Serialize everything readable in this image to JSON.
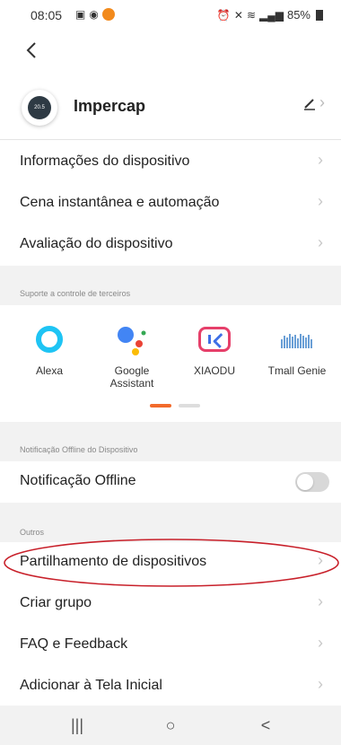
{
  "status_bar": {
    "time": "08:05",
    "battery": "85%"
  },
  "device": {
    "name": "Impercap",
    "avatar_text": "20.5"
  },
  "menu": {
    "info": "Informações do dispositivo",
    "scene": "Cena instantânea e automação",
    "rating": "Avaliação do dispositivo"
  },
  "third_party": {
    "section_label": "Suporte a controle de terceiros",
    "items": [
      {
        "label": "Alexa",
        "icon": "alexa-icon"
      },
      {
        "label": "Google Assistant",
        "icon": "google-assistant-icon"
      },
      {
        "label": "XIAODU",
        "icon": "xiaodu-icon"
      },
      {
        "label": "Tmall Genie",
        "icon": "tmall-genie-icon"
      }
    ],
    "active_page": 1,
    "page_count": 2
  },
  "offline": {
    "section_label": "Notificação Offline do Dispositivo",
    "label": "Notificação Offline",
    "enabled": false
  },
  "others": {
    "section_label": "Outros",
    "share": "Partilhamento de dispositivos",
    "group": "Criar grupo",
    "faq": "FAQ e Feedback",
    "home_screen": "Adicionar à Tela Inicial"
  },
  "nav_bar": {
    "recent_glyph": "|||",
    "home_glyph": "○",
    "back_glyph": "<"
  },
  "colors": {
    "accent": "#f26a2b",
    "highlight_annotation": "#c8202a",
    "alexa": "#1ec4f4"
  }
}
